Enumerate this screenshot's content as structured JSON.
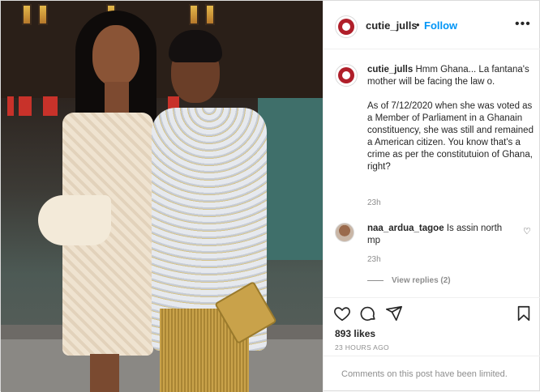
{
  "post": {
    "author": "cutie_julls",
    "follow_label": "Follow",
    "separator": "•",
    "more_label": "•••"
  },
  "caption": {
    "username": "cutie_julls",
    "paragraphs": [
      "Hmm Ghana... La fantana's mother will be facing the law o.",
      "As of 7/12/2020 when she was voted as a Member of Parliament in a Ghanain constituency, she was still and remained a American citizen. You know that's a crime as per the constitutuion of Ghana, right?"
    ],
    "time": "23h"
  },
  "comment": {
    "username": "naa_ardua_tagoe",
    "text": "Is assin north mp",
    "time": "23h",
    "view_replies": "View replies (2)"
  },
  "actions": {
    "likes": "893 likes",
    "date": "23 HOURS AGO"
  },
  "footer": {
    "comments_disabled": "Comments on this post have been limited."
  },
  "icons": [
    "heart-icon",
    "comment-icon",
    "share-icon",
    "bookmark-icon",
    "more-icon"
  ],
  "colors": {
    "accent": "#0095f6",
    "muted": "#8e8e8e",
    "text": "#262626"
  }
}
